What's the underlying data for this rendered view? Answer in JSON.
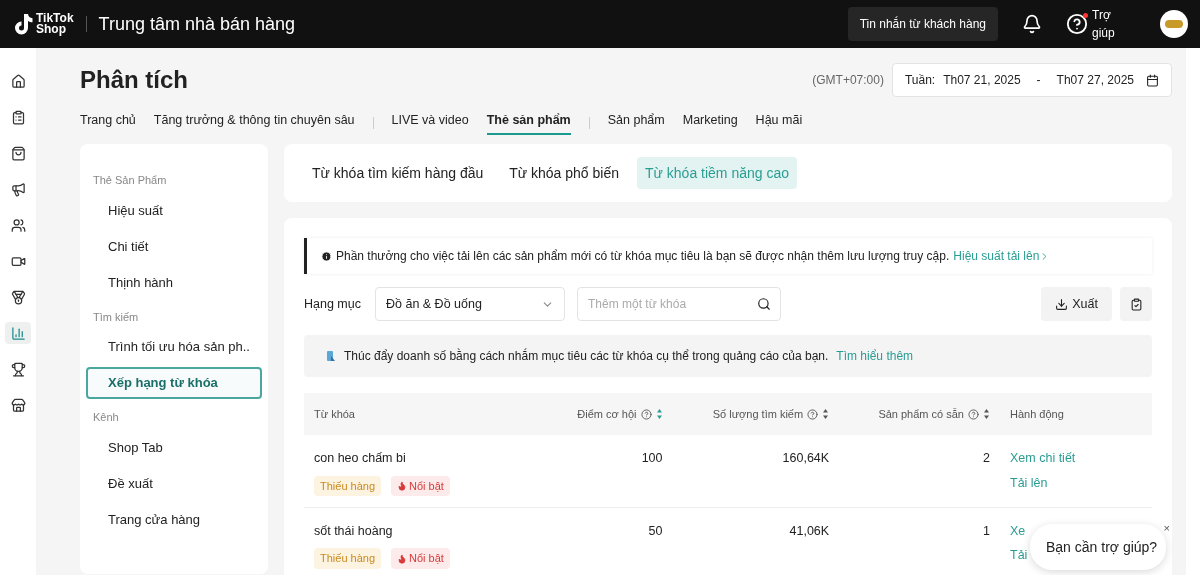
{
  "header": {
    "logo": [
      "TikTok",
      "Shop"
    ],
    "title": "Trung tâm nhà bán hàng",
    "messages_button": "Tin nhắn từ khách hàng",
    "help": {
      "label": "Trợ giúp",
      "has_notification": true
    }
  },
  "rail": [
    {
      "kind": "home",
      "selected": false
    },
    {
      "kind": "clipboard",
      "selected": false
    },
    {
      "kind": "bag",
      "selected": false
    },
    {
      "kind": "megaphone",
      "selected": false
    },
    {
      "kind": "users",
      "selected": false
    },
    {
      "kind": "video",
      "selected": false
    },
    {
      "kind": "medal",
      "selected": false
    },
    {
      "kind": "chart",
      "selected": true
    },
    {
      "kind": "trophy",
      "selected": false
    },
    {
      "kind": "store",
      "selected": false
    }
  ],
  "page_title": "Phân tích",
  "timezone": "(GMT+07:00)",
  "date_range": {
    "label": "Tuần:",
    "start": "Th07 21, 2025",
    "separator": "-",
    "end": "Th07 27, 2025"
  },
  "tab_groups": [
    [
      {
        "label": "Trang chủ",
        "selected": false
      },
      {
        "label": "Tăng trưởng & thông tin chuyên sâu",
        "selected": false
      }
    ],
    [
      {
        "label": "LIVE và video",
        "selected": false
      },
      {
        "label": "Thẻ sản phẩm",
        "selected": true
      }
    ],
    [
      {
        "label": "Sản phẩm",
        "selected": false
      },
      {
        "label": "Marketing",
        "selected": false
      },
      {
        "label": "Hậu mãi",
        "selected": false
      }
    ]
  ],
  "sidebar": [
    {
      "heading": "Thẻ Sản Phẩm",
      "items": [
        {
          "label": "Hiệu suất",
          "selected": false
        },
        {
          "label": "Chi tiết",
          "selected": false
        },
        {
          "label": "Thịnh hành",
          "selected": false
        }
      ]
    },
    {
      "heading": "Tìm kiếm",
      "items": [
        {
          "label": "Trình tối ưu hóa sản ph..",
          "selected": false
        },
        {
          "label": "Xếp hạng từ khóa",
          "selected": true
        }
      ]
    },
    {
      "heading": "Kênh",
      "items": [
        {
          "label": "Shop Tab",
          "selected": false
        },
        {
          "label": "Đề xuất",
          "selected": false
        },
        {
          "label": "Trang cửa hàng",
          "selected": false
        }
      ]
    }
  ],
  "keyword_tabs": [
    {
      "label": "Từ khóa tìm kiếm hàng đầu",
      "selected": false
    },
    {
      "label": "Từ khóa phổ biến",
      "selected": false
    },
    {
      "label": "Từ khóa tiềm năng cao",
      "selected": true
    }
  ],
  "info_banner": {
    "text": "Phần thưởng cho việc tải lên các sản phẩm mới có từ khóa mục tiêu là bạn sẽ được nhận thêm lưu lượng truy cập.",
    "link": "Hiệu suất tải lên"
  },
  "filters": {
    "category_label": "Hạng mục",
    "category_value": "Đồ ăn & Đồ uống",
    "search_placeholder": "Thêm một từ khóa",
    "export_button": "Xuất"
  },
  "promo_banner": {
    "text": "Thúc đẩy doanh số bằng cách nhắm mục tiêu các từ khóa cụ thể trong quảng cáo của bạn.",
    "link": "Tìm hiểu thêm"
  },
  "table": {
    "columns": [
      {
        "label": "Từ khóa",
        "kind": "plain"
      },
      {
        "label": "Điểm cơ hội",
        "kind": "sortable",
        "sorted": true
      },
      {
        "label": "Số lượng tìm kiếm",
        "kind": "sortable",
        "sorted": false
      },
      {
        "label": "Sản phẩm có sẵn",
        "kind": "sortable",
        "sorted": false
      },
      {
        "label": "Hành động",
        "kind": "plain"
      }
    ],
    "rows": [
      {
        "keyword": "con heo chấm bi",
        "tags": [
          {
            "kind": "stock",
            "label": "Thiếu hàng"
          },
          {
            "kind": "hot",
            "label": "Nổi bật"
          }
        ],
        "score": "100",
        "volume": "160,64K",
        "available": "2",
        "actions": [
          "Xem chi tiết",
          "Tải lên"
        ]
      },
      {
        "keyword": "sốt thái hoàng",
        "tags": [
          {
            "kind": "stock",
            "label": "Thiếu hàng"
          },
          {
            "kind": "hot",
            "label": "Nổi bật"
          }
        ],
        "score": "50",
        "volume": "41,06K",
        "available": "1",
        "actions": [
          "Xe",
          "Tải"
        ]
      }
    ]
  },
  "help_popup": {
    "text": "Bạn cần trợ giúp?",
    "close": "×"
  }
}
